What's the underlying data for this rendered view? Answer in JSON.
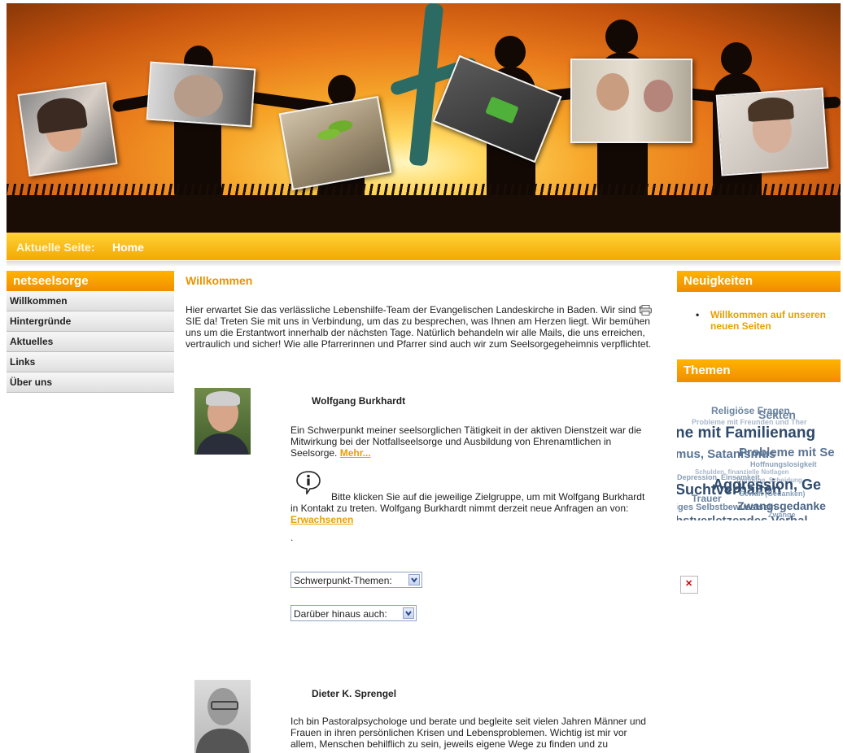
{
  "breadcrumb": {
    "label": "Aktuelle Seite:",
    "value": "Home"
  },
  "nav": {
    "title": "netseelsorge",
    "items": [
      {
        "label": "Willkommen"
      },
      {
        "label": "Hintergründe"
      },
      {
        "label": "Aktuelles"
      },
      {
        "label": "Links"
      },
      {
        "label": "Über uns"
      }
    ]
  },
  "main": {
    "title": "Willkommen",
    "intro": "Hier erwartet Sie das verlässliche Lebenshilfe-Team der Evangelischen Landeskirche in Baden. Wir sind für SIE da!  Treten Sie mit uns in Verbindung, um das zu besprechen, was Ihnen am Herzen liegt. Wir bemühen uns um die Erstantwort innerhalb der nächsten Tage. Natürlich behandeln wir alle Mails, die uns erreichen, vertraulich und sicher! Wie alle Pfarrerinnen und Pfarrer sind auch wir zum Seelsorgegeheimnis verpflichtet.",
    "counselors": [
      {
        "name": "Wolfgang Burkhardt",
        "bio": "Ein Schwerpunkt meiner seelsorglichen Tätigkeit in der aktiven Dienstzeit war die Mitwirkung bei der Notfallseelsorge und Ausbildung von Ehrenamtlichen in Seelsorge.",
        "more_link": "Mehr...",
        "contact_text": "Bitte klicken Sie auf die jeweilige Zielgruppe, um mit Wolfgang Burkhardt in Kontakt zu treten. Wolfgang Burkhardt nimmt derzeit neue Anfragen an von:",
        "contact_link": "Erwachsenen",
        "dot": ".",
        "select1": "Schwerpunkt-Themen:",
        "select2": "Darüber hinaus auch:"
      },
      {
        "name": "Dieter K. Sprengel",
        "bio": "Ich bin Pastoralpsychologe und berate und begleite seit vielen Jahren Männer und Frauen in ihren persönlichen Krisen und Lebensproblemen. Wichtig ist mir vor allem, Menschen behilflich zu sein, jeweils eigene Wege zu finden und zu"
      }
    ]
  },
  "sidebar": {
    "news_title": "Neuigkeiten",
    "news_items": [
      {
        "label": "Willkommen auf unseren neuen Seiten"
      }
    ],
    "topics_title": "Themen",
    "tags": [
      "Religiöse Fragen",
      "Sekten",
      "Probleme mit Freunden und Ther",
      "ne mit Familienang",
      "mus, Satanismus",
      "Probleme mit Se",
      "Hoffnungslosigkeit",
      "Schulden, finanzielle Notlagen",
      "Trennung, Scheidung",
      "Depression, Einsamkeit",
      "Suchtverhalten",
      "Aggression, Ge",
      "Gewalt (Gedanken)",
      "Trauer",
      "iges Selbstbewusstsein",
      "Zwangsgedanke",
      "Zwänge",
      "bstverletzendes Verhal"
    ]
  },
  "colors": {
    "accent": "#f39c00",
    "link": "#e8a000",
    "header_bar": "#ffc21a"
  }
}
